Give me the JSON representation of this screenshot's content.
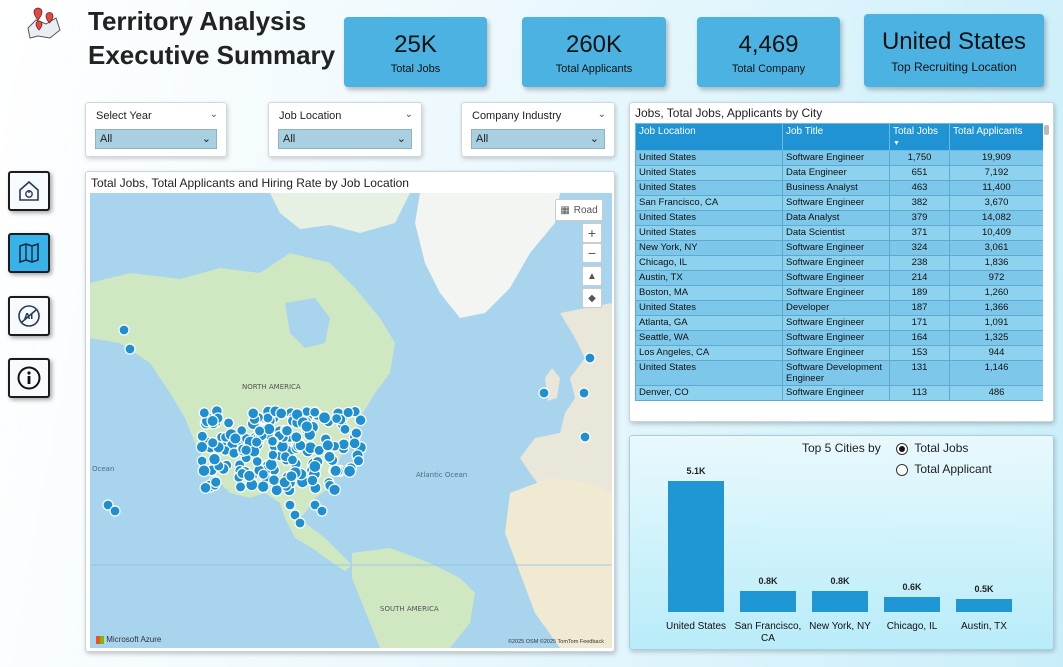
{
  "header": {
    "title_line1": "Territory Analysis",
    "title_line2": "Executive Summary"
  },
  "kpis": [
    {
      "value": "25K",
      "label": "Total Jobs"
    },
    {
      "value": "260K",
      "label": "Total Applicants"
    },
    {
      "value": "4,469",
      "label": "Total Company"
    },
    {
      "value": "United States",
      "label": "Top Recruiting Location"
    }
  ],
  "nav": [
    {
      "icon": "home-icon"
    },
    {
      "icon": "map-icon"
    },
    {
      "icon": "ai-compass-icon"
    },
    {
      "icon": "info-icon"
    }
  ],
  "slicers": [
    {
      "title": "Select Year",
      "value": "All"
    },
    {
      "title": "Job Location",
      "value": "All"
    },
    {
      "title": "Company Industry",
      "value": "All"
    }
  ],
  "map": {
    "title": "Total Jobs, Total Applicants and Hiring Rate by Job Location",
    "style_button": "Road",
    "labels": {
      "north_america": "NORTH AMERICA",
      "south_america": "SOUTH AMERICA",
      "atlantic": "Atlantic Ocean",
      "ocean": "Ocean"
    },
    "brand": "Microsoft Azure",
    "attribution": "©2025 OSM ©2025 TomTom Feedback",
    "colors": {
      "water": "#a8d4ee",
      "land": "#cfe8c2",
      "marker": "#1f8fcf"
    }
  },
  "table": {
    "title": "Jobs, Total Jobs, Applicants by City",
    "columns": [
      "Job Location",
      "Job Title",
      "Total Jobs",
      "Total Applicants"
    ],
    "rows": [
      [
        "United States",
        "Software Engineer",
        "1,750",
        "19,909"
      ],
      [
        "United States",
        "Data Engineer",
        "651",
        "7,192"
      ],
      [
        "United States",
        "Business Analyst",
        "463",
        "11,400"
      ],
      [
        "San Francisco, CA",
        "Software Engineer",
        "382",
        "3,670"
      ],
      [
        "United States",
        "Data Analyst",
        "379",
        "14,082"
      ],
      [
        "United States",
        "Data Scientist",
        "371",
        "10,409"
      ],
      [
        "New York, NY",
        "Software Engineer",
        "324",
        "3,061"
      ],
      [
        "Chicago, IL",
        "Software Engineer",
        "238",
        "1,836"
      ],
      [
        "Austin, TX",
        "Software Engineer",
        "214",
        "972"
      ],
      [
        "Boston, MA",
        "Software Engineer",
        "189",
        "1,260"
      ],
      [
        "United States",
        "Developer",
        "187",
        "1,366"
      ],
      [
        "Atlanta, GA",
        "Software Engineer",
        "171",
        "1,091"
      ],
      [
        "Seattle, WA",
        "Software Engineer",
        "164",
        "1,325"
      ],
      [
        "Los Angeles, CA",
        "Software Engineer",
        "153",
        "944"
      ],
      [
        "United States",
        "Software Development Engineer",
        "131",
        "1,146"
      ],
      [
        "Denver, CO",
        "Software Engineer",
        "113",
        "486"
      ]
    ]
  },
  "top5": {
    "title": "Top 5 Cities by",
    "options": [
      {
        "label": "Total Jobs",
        "selected": true
      },
      {
        "label": "Total Applicant",
        "selected": false
      }
    ]
  },
  "chart_data": {
    "type": "bar",
    "categories": [
      "United States",
      "San Francisco, CA",
      "New York, NY",
      "Chicago, IL",
      "Austin, TX"
    ],
    "values": [
      5100,
      800,
      800,
      600,
      500
    ],
    "data_labels": [
      "5.1K",
      "0.8K",
      "0.8K",
      "0.6K",
      "0.5K"
    ],
    "title": "Top 5 Cities by",
    "color": "#1f97d4"
  }
}
